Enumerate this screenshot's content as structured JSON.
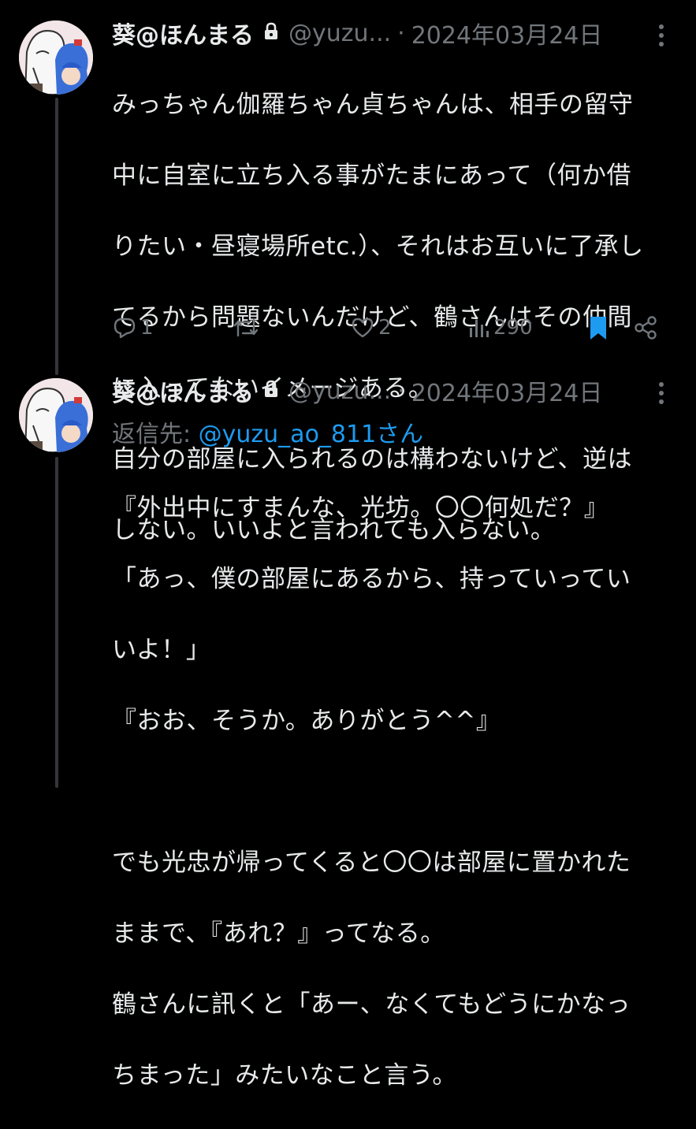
{
  "tweets": [
    {
      "author": {
        "display_name": "葵@ほんまる",
        "handle": "@yuzu...",
        "protected_icon": "lock-icon"
      },
      "separator": "·",
      "date": "2024年03月24日",
      "lines": [
        "みっちゃん伽羅ちゃん貞ちゃんは、相手の留守",
        "中に自室に立ち入る事がたまにあって（何か借",
        "りたい・昼寝場所etc.）、それはお互いに了承し",
        "てるから問題ないんだけど、鶴さんはその仲間",
        "に入ってないイメージある。",
        "自分の部屋に入られるのは構わないけど、逆は",
        "しない。いいよと言われても入らない。"
      ],
      "actions": {
        "reply_count": "1",
        "retweet_count": "",
        "like_count": "2",
        "view_count": "290"
      }
    },
    {
      "author": {
        "display_name": "葵@ほんまる",
        "handle": "@yuzu...",
        "protected_icon": "lock-icon"
      },
      "separator": "·",
      "date": "2024年03月24日",
      "reply_label": "返信先: ",
      "reply_mention": "@yuzu_ao_811さん",
      "lines": [
        "『外出中にすまんな、光坊。〇〇何処だ？』",
        "「あっ、僕の部屋にあるから、持っていってい",
        "いよ！」",
        "『おお、そうか。ありがとう^^』",
        "",
        "でも光忠が帰ってくると〇〇は部屋に置かれた",
        "ままで、『あれ？』ってなる。",
        "鶴さんに訊くと「あー、なくてもどうにかなっ",
        "ちまった」みたいなこと言う。"
      ]
    }
  ],
  "colors": {
    "background": "#000000",
    "text": "#e7e9ea",
    "muted": "#71767b",
    "accent": "#1d9bf0",
    "thread_line": "#333639"
  }
}
